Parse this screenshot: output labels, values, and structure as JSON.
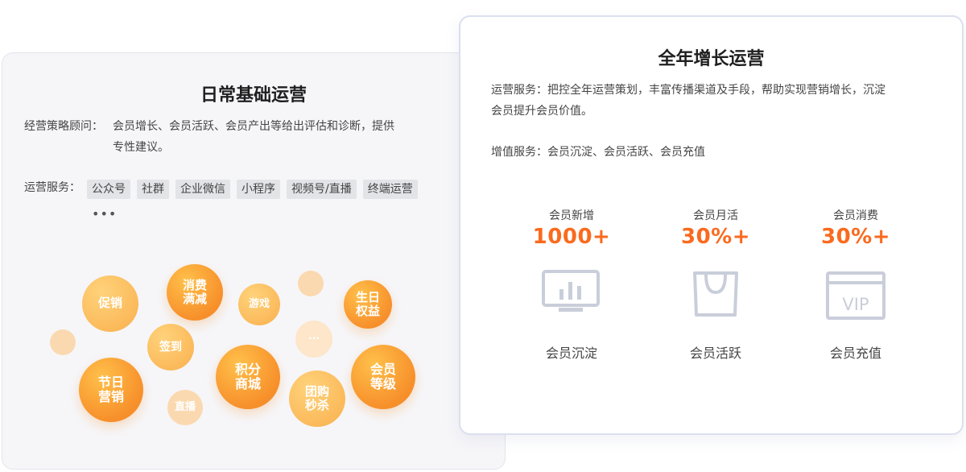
{
  "left": {
    "title": "日常基础运营",
    "consult_label": "经营策略顾问：",
    "consult_line1": "会员增长、会员活跃、会员产出等给出评估和诊断，提供",
    "consult_line2": "专性建议。",
    "services_label": "运营服务：",
    "tags": [
      "公众号",
      "社群",
      "企业微信",
      "小程序",
      "视频号/直播",
      "终端运营"
    ],
    "more": "•••",
    "bubbles": [
      "促销",
      "消费\n满减",
      "游戏",
      "生日\n权益",
      "签到",
      "···",
      "节日\n营销",
      "积分\n商城",
      "会员\n等级",
      "直播",
      "团购\n秒杀"
    ]
  },
  "right": {
    "title": "全年增长运营",
    "services_line1": "运营服务：把控全年运营策划，丰富传播渠道及手段，帮助实现营销增长，沉淀",
    "services_line2": "会员提升会员价值。",
    "added": "增值服务：会员沉淀、会员活跃、会员充值",
    "stats": [
      {
        "label": "会员新增",
        "value": "1000+",
        "icon": "monitor-chart-icon",
        "caption": "会员沉淀"
      },
      {
        "label": "会员月活",
        "value": "30%+",
        "icon": "shopping-bag-icon",
        "caption": "会员活跃"
      },
      {
        "label": "会员消费",
        "value": "30%+",
        "icon": "vip-card-icon",
        "caption": "会员充值"
      }
    ],
    "vip_text": "VIP",
    "icon_color": "#c9ceda"
  },
  "colors": {
    "accent": "#fa6a1e",
    "bubble_orange": "#f7902b",
    "bubble_light": "#fbd9b0"
  }
}
